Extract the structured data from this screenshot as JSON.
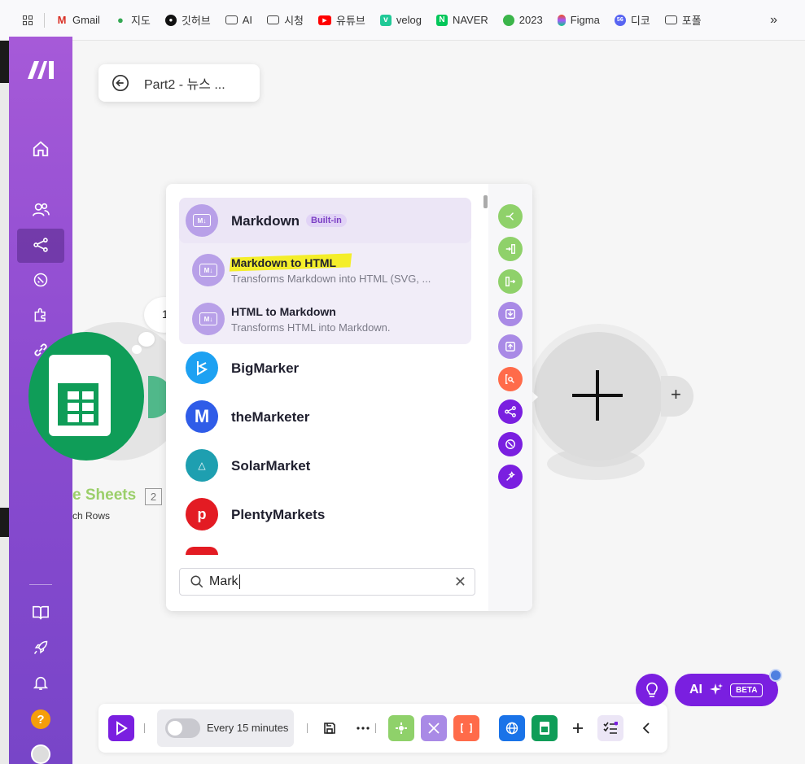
{
  "bookmarks": [
    {
      "label": "Gmail"
    },
    {
      "label": "지도"
    },
    {
      "label": "깃허브"
    },
    {
      "label": "AI"
    },
    {
      "label": "시청"
    },
    {
      "label": "유튜브"
    },
    {
      "label": "velog"
    },
    {
      "label": "NAVER"
    },
    {
      "label": "2023"
    },
    {
      "label": "Figma"
    },
    {
      "label": "디코"
    },
    {
      "label": "포폴"
    }
  ],
  "bookmarks_more": "»",
  "scenario": {
    "title": "Part2 - 뉴스 ..."
  },
  "sheets_module": {
    "name": "e Sheets",
    "count": "2",
    "subtitle": "ch Rows",
    "badge": "1"
  },
  "picker": {
    "group": {
      "name": "Markdown",
      "badge": "Built-in",
      "actions": [
        {
          "name": "Markdown to HTML",
          "desc": "Transforms Markdown into HTML (SVG, ..."
        },
        {
          "name": "HTML to Markdown",
          "desc": "Transforms HTML into Markdown."
        }
      ]
    },
    "apps": [
      {
        "name": "BigMarker",
        "color": "#1da1f2"
      },
      {
        "name": "theMarketer",
        "color": "#2f5ce8"
      },
      {
        "name": "SolarMarket",
        "color": "#1e9fb0"
      },
      {
        "name": "PlentyMarkets",
        "color": "#e31b23"
      }
    ],
    "search": {
      "value": "Mark",
      "clear": "✕"
    }
  },
  "rail_colors": [
    "#8fd16a",
    "#8fd16a",
    "#8fd16a",
    "#a98ae6",
    "#a98ae6",
    "#ff6b4a",
    "#7a1fe0",
    "#7a1fe0",
    "#7a1fe0"
  ],
  "add_button": "+",
  "toolbar": {
    "schedule": "Every 15 minutes"
  },
  "ai": {
    "label": "AI",
    "beta": "BETA"
  },
  "help": "?"
}
